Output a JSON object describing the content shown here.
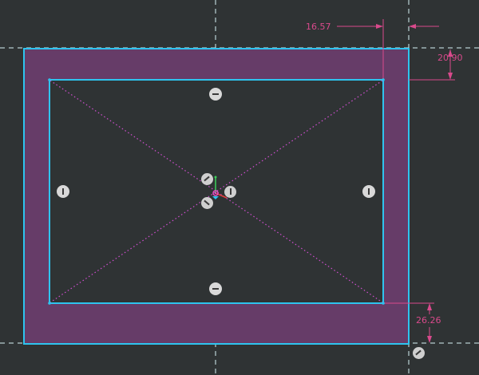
{
  "colors": {
    "background": "#2f3334",
    "frame_fill": "#663c68",
    "edge": "#2ec4ef",
    "guide": "#d7f3f6",
    "dimension": "#d94a8c",
    "diagonal": "#d04fd0",
    "handle": "#d9d9d9"
  },
  "dimensions": {
    "top_width": "16.57",
    "right_height": "20.90",
    "bottom_height": "26.26"
  },
  "handles": [
    {
      "name": "top-edge-handle",
      "icon": "minus-icon"
    },
    {
      "name": "bottom-edge-handle",
      "icon": "minus-icon"
    },
    {
      "name": "left-edge-handle",
      "icon": "bar-icon"
    },
    {
      "name": "right-edge-handle",
      "icon": "bar-icon"
    },
    {
      "name": "center-rotate-handle-upper",
      "icon": "rotate-icon"
    },
    {
      "name": "center-rotate-handle-lower",
      "icon": "rotate-icon"
    },
    {
      "name": "center-move-handle",
      "icon": "move-icon"
    },
    {
      "name": "corner-settings-handle",
      "icon": "gear-icon"
    }
  ]
}
